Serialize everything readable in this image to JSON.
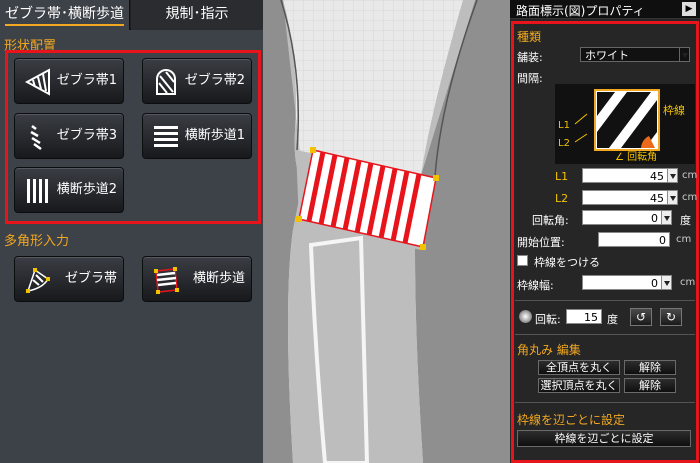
{
  "left_tabs": {
    "active": "ゼブラ帯･横断歩道",
    "other": "規制･指示"
  },
  "shape_section": {
    "title": "形状配置",
    "buttons": [
      {
        "label": "ゼブラ帯1",
        "icon": "zebra-wedge-icon"
      },
      {
        "label": "ゼブラ帯2",
        "icon": "zebra-arch-icon"
      },
      {
        "label": "ゼブラ帯3",
        "icon": "zebra-diagonal-icon"
      },
      {
        "label": "横断歩道1",
        "icon": "crosswalk-horizontal-icon"
      },
      {
        "label": "横断歩道2",
        "icon": "crosswalk-vertical-icon"
      }
    ]
  },
  "polygon_section": {
    "title": "多角形入力",
    "buttons": [
      {
        "label": "ゼブラ帯",
        "icon": "polygon-zebra-icon"
      },
      {
        "label": "横断歩道",
        "icon": "polygon-crosswalk-icon"
      }
    ]
  },
  "panel": {
    "title": "路面標示(図)プロパティ",
    "kind_header": "種類",
    "paving_label": "舗装:",
    "paving_value": "ホワイト",
    "interval_label": "間隔:",
    "diagram": {
      "frame_line": "枠線",
      "l1": "L1",
      "l2": "L2",
      "angle": "∠ 回転角"
    },
    "l1_label": "L1",
    "l1_value": "45",
    "l1_unit": "cm",
    "l2_label": "L2",
    "l2_value": "45",
    "l2_unit": "cm",
    "rot_label": "回転角:",
    "rot_value": "0",
    "rot_unit": "度",
    "start_label": "開始位置:",
    "start_value": "0",
    "start_unit": "cm",
    "frame_check_label": "枠線をつける",
    "frame_width_label": "枠線幅:",
    "frame_width_value": "0",
    "frame_width_unit": "cm",
    "rotate_label": "回転:",
    "rotate_value": "15",
    "rotate_unit": "度",
    "round_header": "角丸み 編集",
    "round_all": "全頂点を丸く",
    "round_all_clear": "解除",
    "round_sel": "選択頂点を丸く",
    "round_sel_clear": "解除",
    "edge_header": "枠線を辺ごとに設定",
    "edge_button": "枠線を辺ごとに設定"
  },
  "colors": {
    "accent": "#f2a820",
    "highlight": "#e8141b"
  }
}
